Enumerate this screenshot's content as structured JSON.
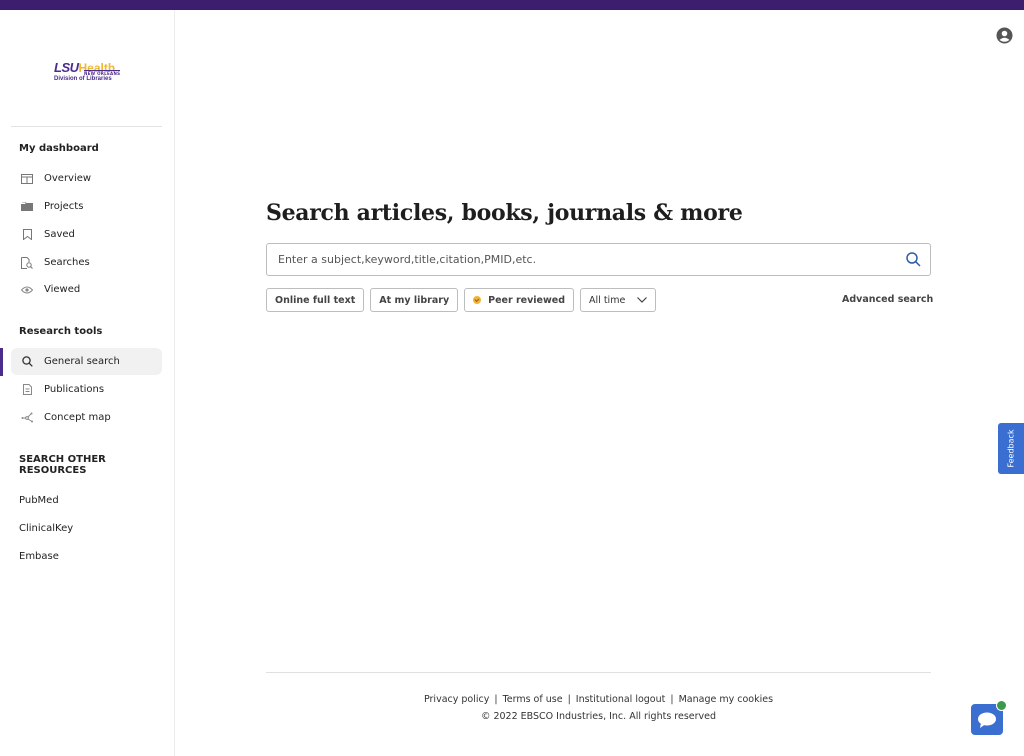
{
  "brand": {
    "logo_primary": "LSU",
    "logo_secondary": "Health",
    "logo_location": "NEW ORLEANS",
    "logo_subtitle": "Division of Libraries",
    "topbar_color": "#3d1d6e",
    "accent_color": "#4b2c8c"
  },
  "sidebar": {
    "dashboard_heading": "My dashboard",
    "dashboard_items": [
      {
        "label": "Overview",
        "icon": "columns-icon"
      },
      {
        "label": "Projects",
        "icon": "folder-icon"
      },
      {
        "label": "Saved",
        "icon": "bookmark-icon"
      },
      {
        "label": "Searches",
        "icon": "search-document-icon"
      },
      {
        "label": "Viewed",
        "icon": "eye-icon"
      }
    ],
    "tools_heading": "Research tools",
    "tools_items": [
      {
        "label": "General search",
        "icon": "search-icon",
        "active": true
      },
      {
        "label": "Publications",
        "icon": "document-icon"
      },
      {
        "label": "Concept map",
        "icon": "concept-map-icon"
      }
    ],
    "other_heading": "SEARCH OTHER RESOURCES",
    "other_links": [
      "PubMed",
      "ClinicalKey",
      "Embase"
    ]
  },
  "main": {
    "title": "Search articles, books, journals & more",
    "search": {
      "value": "",
      "placeholder": "Enter a subject,keyword,title,citation,PMID,etc."
    },
    "filters": {
      "online_full_text": "Online full text",
      "at_my_library": "At my library",
      "peer_reviewed": "Peer reviewed",
      "peer_reviewed_checked": true,
      "date_range_selected": "All time"
    },
    "advanced_search": "Advanced search"
  },
  "feedback_label": "Feedback",
  "footer": {
    "links": [
      "Privacy policy",
      "Terms of use",
      "Institutional logout",
      "Manage my cookies"
    ],
    "copyright": "© 2022 EBSCO Industries, Inc. All rights reserved"
  }
}
